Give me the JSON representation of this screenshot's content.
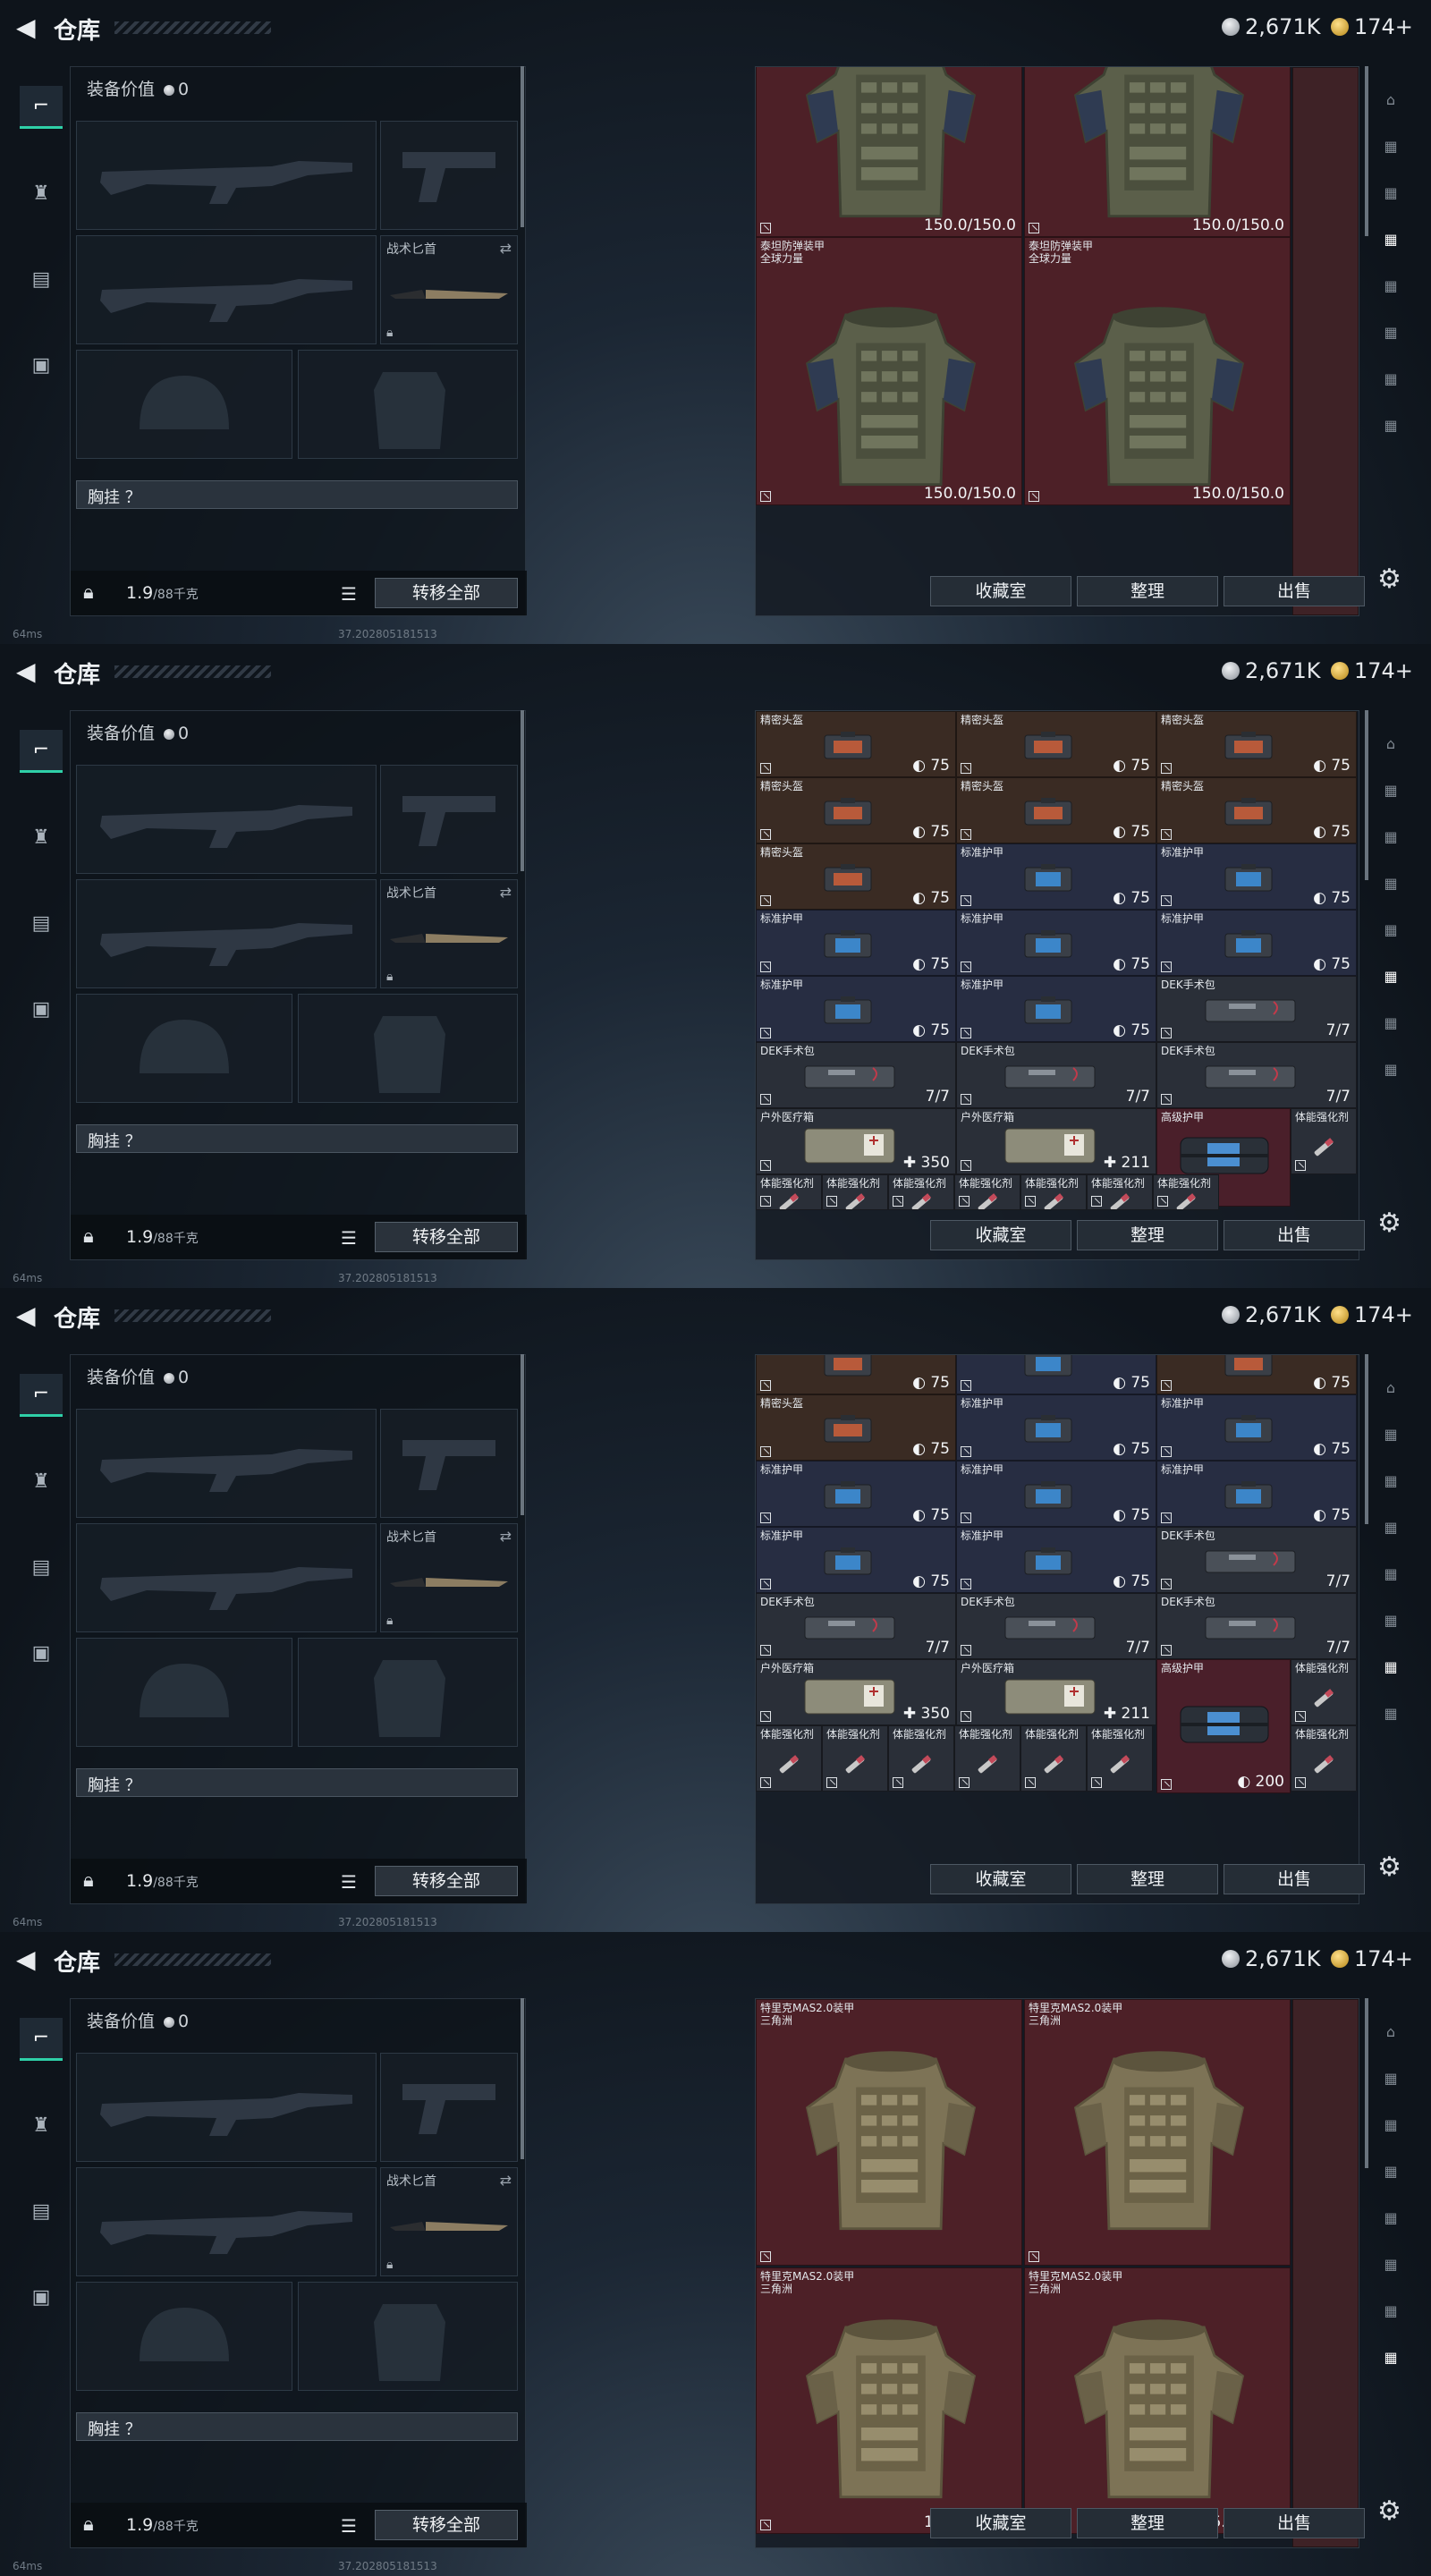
{
  "header": {
    "title": "仓库",
    "currency_silver": "2,671K",
    "currency_gold": "174+"
  },
  "equipment": {
    "value_label": "装备价值",
    "value": "0",
    "knife_label": "战术匕首",
    "vest_label": "胸挂 ？",
    "weight_current": "1.9",
    "weight_max": "/88千克",
    "transfer_all": "转移全部"
  },
  "actions": {
    "collection": "收藏室",
    "organize": "整理",
    "sell": "出售"
  },
  "status": {
    "ping": "64ms",
    "build": "37.202805181513"
  },
  "nav_icons": [
    "gun-icon",
    "helmet-icon",
    "clipboard-icon",
    "briefcase-icon"
  ],
  "right_nav_icons": [
    "tab-icon-1",
    "tab-icon-2",
    "tab-icon-3",
    "tab-icon-4",
    "tab-icon-5",
    "tab-icon-6",
    "tab-icon-7",
    "tab-icon-8"
  ],
  "panels": [
    {
      "active_tab": 3,
      "cells": [
        {
          "name": "",
          "value": "150.0/150.0",
          "color": "red",
          "kind": "vest-green"
        },
        {
          "name": "",
          "value": "150.0/150.0",
          "color": "red",
          "kind": "vest-green"
        },
        {
          "name": "泰坦防弹装甲\n全球力量",
          "value": "150.0/150.0",
          "color": "red",
          "kind": "vest-green"
        },
        {
          "name": "泰坦防弹装甲\n全球力量",
          "value": "150.0/150.0",
          "color": "red",
          "kind": "vest-green"
        }
      ]
    },
    {
      "active_tab": 5,
      "rows": [
        [
          {
            "name": "精密头盔",
            "value": "75",
            "color": "brown"
          },
          {
            "name": "精密头盔",
            "value": "75",
            "color": "brown"
          },
          {
            "name": "精密头盔",
            "value": "75",
            "color": "brown"
          }
        ],
        [
          {
            "name": "精密头盔",
            "value": "75",
            "color": "brown"
          },
          {
            "name": "精密头盔",
            "value": "75",
            "color": "brown"
          },
          {
            "name": "精密头盔",
            "value": "75",
            "color": "brown"
          }
        ],
        [
          {
            "name": "精密头盔",
            "value": "75",
            "color": "brown"
          },
          {
            "name": "标准护甲",
            "value": "75",
            "color": "blue"
          },
          {
            "name": "标准护甲",
            "value": "75",
            "color": "blue"
          }
        ],
        [
          {
            "name": "标准护甲",
            "value": "75",
            "color": "blue"
          },
          {
            "name": "标准护甲",
            "value": "75",
            "color": "blue"
          },
          {
            "name": "标准护甲",
            "value": "75",
            "color": "blue"
          }
        ],
        [
          {
            "name": "标准护甲",
            "value": "75",
            "color": "blue"
          },
          {
            "name": "标准护甲",
            "value": "75",
            "color": "blue"
          },
          {
            "name": "DEK手术包",
            "value": "7/7",
            "color": "gray"
          }
        ],
        [
          {
            "name": "DEK手术包",
            "value": "7/7",
            "color": "gray"
          },
          {
            "name": "DEK手术包",
            "value": "7/7",
            "color": "gray"
          },
          {
            "name": "DEK手术包",
            "value": "7/7",
            "color": "gray"
          }
        ],
        [
          {
            "name": "户外医疗箱",
            "value": "350",
            "color": "gray"
          },
          {
            "name": "户外医疗箱",
            "value": "211",
            "color": "gray"
          },
          {
            "name": "高级护甲",
            "value": "",
            "color": "pink"
          },
          {
            "name": "体能强化剂",
            "value": "",
            "color": "gray"
          }
        ]
      ],
      "small_row": [
        "体能强化剂",
        "体能强化剂",
        "体能强化剂",
        "体能强化剂",
        "体能强化剂",
        "体能强化剂",
        "体能强化剂"
      ]
    },
    {
      "active_tab": 6,
      "rows": [
        [
          {
            "name": "",
            "value": "75",
            "color": "brown"
          },
          {
            "name": "",
            "value": "75",
            "color": "blue"
          },
          {
            "name": "",
            "value": "75",
            "color": "brown"
          }
        ],
        [
          {
            "name": "精密头盔",
            "value": "75",
            "color": "brown"
          },
          {
            "name": "标准护甲",
            "value": "75",
            "color": "blue"
          },
          {
            "name": "标准护甲",
            "value": "75",
            "color": "blue"
          }
        ],
        [
          {
            "name": "标准护甲",
            "value": "75",
            "color": "blue"
          },
          {
            "name": "标准护甲",
            "value": "75",
            "color": "blue"
          },
          {
            "name": "标准护甲",
            "value": "75",
            "color": "blue"
          }
        ],
        [
          {
            "name": "标准护甲",
            "value": "75",
            "color": "blue"
          },
          {
            "name": "标准护甲",
            "value": "75",
            "color": "blue"
          },
          {
            "name": "DEK手术包",
            "value": "7/7",
            "color": "gray"
          }
        ],
        [
          {
            "name": "DEK手术包",
            "value": "7/7",
            "color": "gray"
          },
          {
            "name": "DEK手术包",
            "value": "7/7",
            "color": "gray"
          },
          {
            "name": "DEK手术包",
            "value": "7/7",
            "color": "gray"
          }
        ]
      ],
      "med_row": [
        {
          "name": "户外医疗箱",
          "value": "350"
        },
        {
          "name": "户外医疗箱",
          "value": "211"
        }
      ],
      "adv_armor": {
        "name": "高级护甲",
        "value": "200"
      },
      "stim_labels": [
        "体能强化剂",
        "体能强化剂",
        "体能强化剂",
        "体能强化剂",
        "体能强化剂",
        "体能强化剂",
        "体能强化剂",
        "体能强化剂"
      ]
    },
    {
      "active_tab": 7,
      "cells": [
        {
          "name": "特里克MAS2.0装甲\n三角洲",
          "value": "",
          "color": "red",
          "kind": "vest-tan"
        },
        {
          "name": "特里克MAS2.0装甲\n三角洲",
          "value": "",
          "color": "red",
          "kind": "vest-tan"
        },
        {
          "name": "特里克MAS2.0装甲\n三角洲",
          "value": "125.0/125.0",
          "color": "red",
          "kind": "vest-tan"
        },
        {
          "name": "特里克MAS2.0装甲\n三角洲",
          "value": "125.0/125.0",
          "color": "red",
          "kind": "vest-tan"
        }
      ]
    }
  ]
}
